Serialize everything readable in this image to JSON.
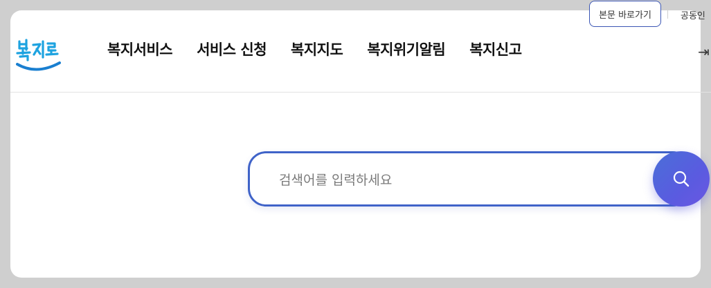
{
  "logo": {
    "alt": "복지로"
  },
  "nav": {
    "items": [
      {
        "label": "복지서비스"
      },
      {
        "label": "서비스 신청"
      },
      {
        "label": "복지지도"
      },
      {
        "label": "복지위기알림"
      },
      {
        "label": "복지신고"
      }
    ]
  },
  "top": {
    "skip_label": "본문 바로가기",
    "cert_label": "공동인"
  },
  "login": {
    "icon": "login-arrow-icon",
    "glyph": "⇥"
  },
  "search": {
    "placeholder": "검색어를 입력하세요",
    "value": ""
  },
  "colors": {
    "accent": "#3f63c8",
    "button_start": "#4a6fd8",
    "button_end": "#6a57e2"
  }
}
